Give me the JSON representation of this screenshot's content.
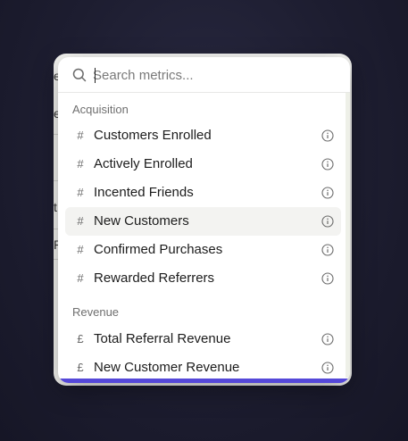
{
  "search": {
    "placeholder": "Search metrics...",
    "value": "",
    "icon": "search-icon"
  },
  "groups": [
    {
      "label": "Acquisition",
      "items": [
        {
          "glyph": "#",
          "label": "Customers Enrolled",
          "icon": "info-icon"
        },
        {
          "glyph": "#",
          "label": "Actively Enrolled",
          "icon": "info-icon"
        },
        {
          "glyph": "#",
          "label": "Incented Friends",
          "icon": "info-icon"
        },
        {
          "glyph": "#",
          "label": "New Customers",
          "icon": "info-icon",
          "highlighted": true
        },
        {
          "glyph": "#",
          "label": "Confirmed Purchases",
          "icon": "info-icon"
        },
        {
          "glyph": "#",
          "label": "Rewarded Referrers",
          "icon": "info-icon"
        }
      ]
    },
    {
      "label": "Revenue",
      "items": [
        {
          "glyph": "£",
          "label": "Total Referral Revenue",
          "icon": "info-icon"
        },
        {
          "glyph": "£",
          "label": "New Customer Revenue",
          "icon": "info-icon"
        }
      ]
    }
  ],
  "behind": {
    "chars": [
      "e",
      "e",
      "t",
      "P"
    ]
  },
  "colors": {
    "accent": "#5548d9",
    "highlight": "#f3f3f1",
    "backdrop": "#1d1d30"
  }
}
